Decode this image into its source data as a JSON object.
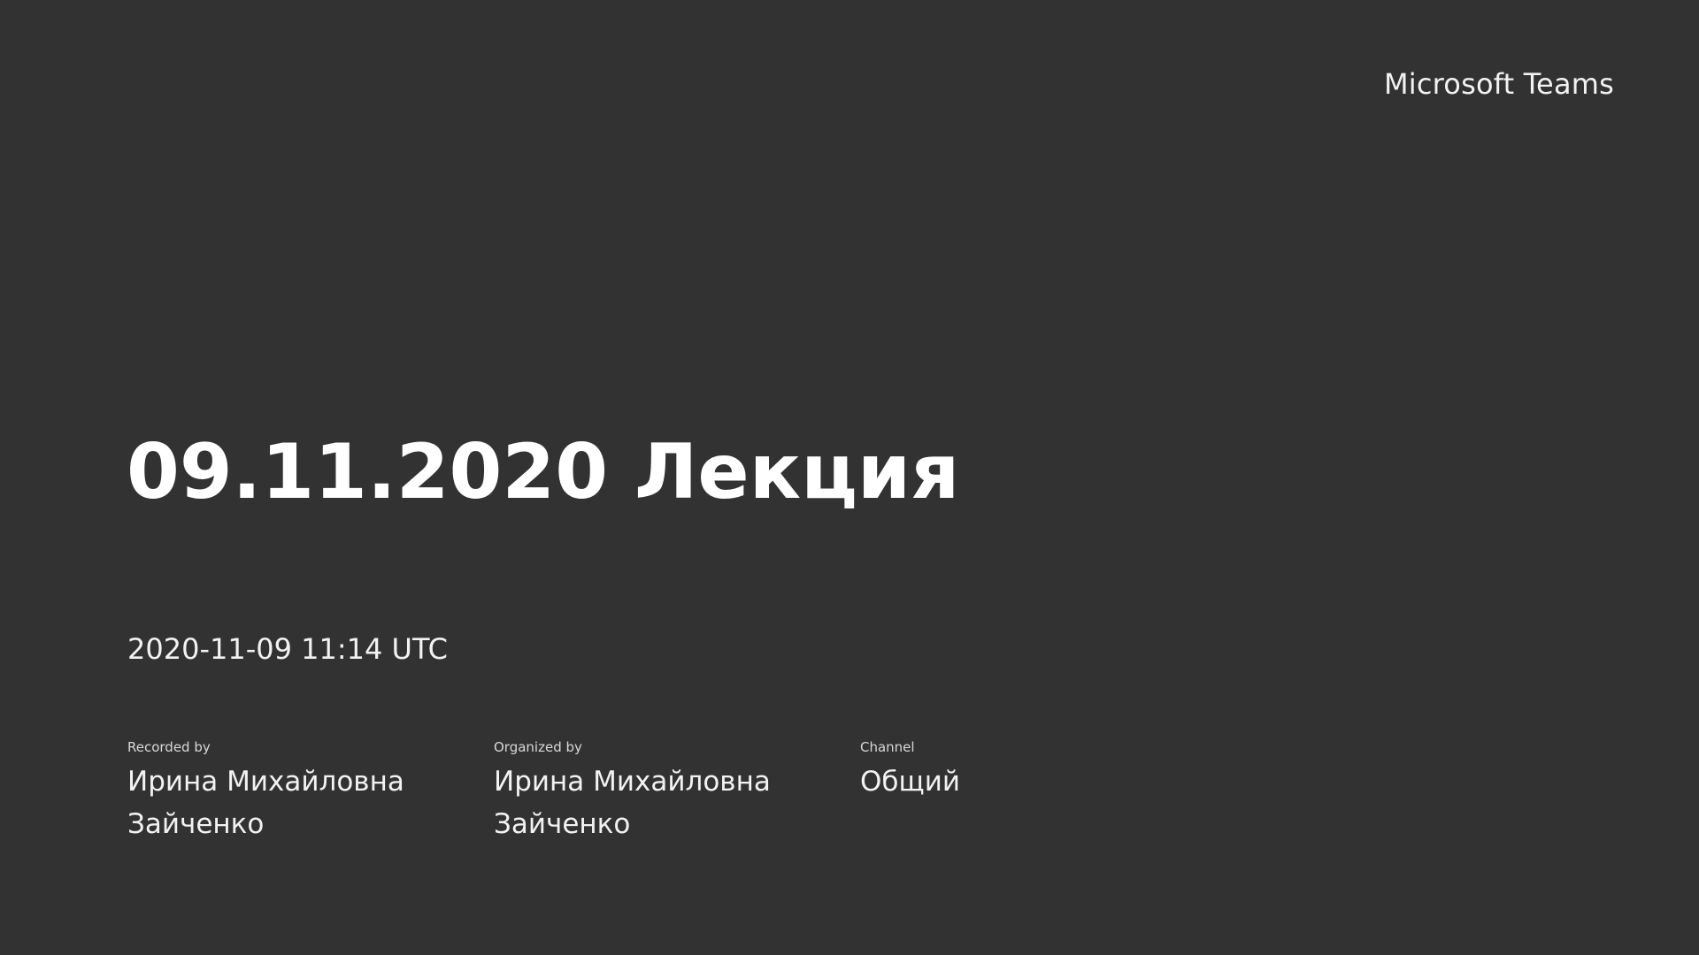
{
  "brand": "Microsoft Teams",
  "title": "09.11.2020 Лекция",
  "timestamp": "2020-11-09 11:14 UTC",
  "meta": {
    "recorded_by": {
      "label": "Recorded by",
      "value": "Ирина Михайловна Зайченко"
    },
    "organized_by": {
      "label": "Organized by",
      "value": "Ирина Михайловна Зайченко"
    },
    "channel": {
      "label": "Channel",
      "value": "Общий"
    }
  },
  "colors": {
    "background": "#323232",
    "text": "#ffffff"
  }
}
